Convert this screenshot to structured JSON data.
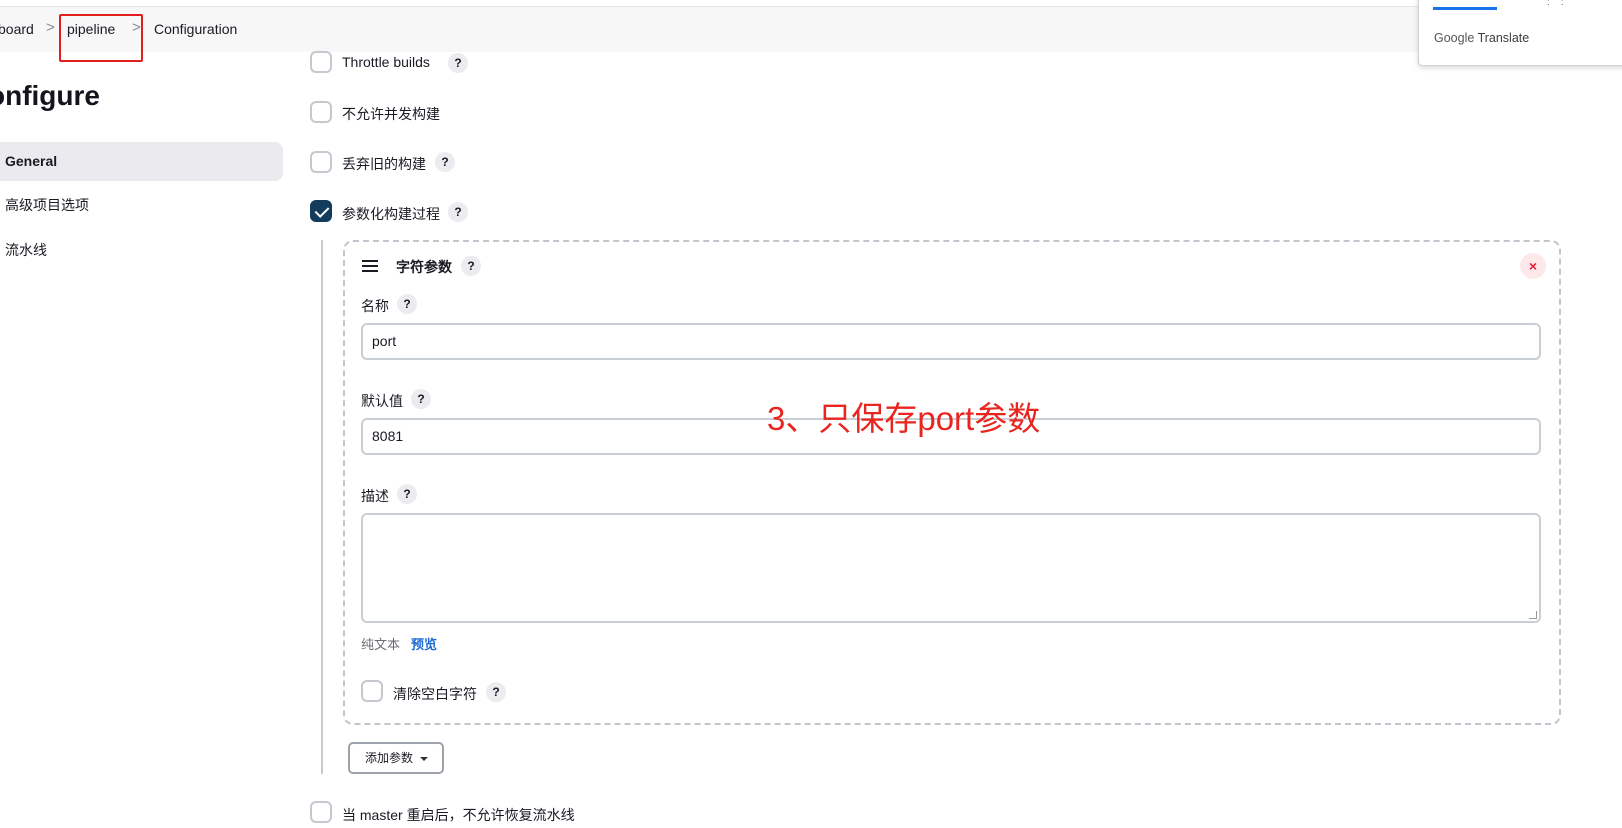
{
  "breadcrumb": {
    "items": [
      "board",
      "pipeline",
      "Configuration"
    ],
    "separator": ">"
  },
  "google_translate": {
    "brand": "Google",
    "product": "Translate"
  },
  "page": {
    "title": "onfigure"
  },
  "sidebar": {
    "items": [
      {
        "label": "General",
        "active": true
      },
      {
        "label": "高级项目选项",
        "active": false
      },
      {
        "label": "流水线",
        "active": false
      }
    ]
  },
  "options": {
    "throttle": {
      "label": "Throttle builds",
      "checked": false
    },
    "no_concurrent": {
      "label": "不允许并发构建",
      "checked": false
    },
    "discard_old": {
      "label": "丢弃旧的构建",
      "checked": false
    },
    "parameterized": {
      "label": "参数化构建过程",
      "checked": true
    },
    "no_resume": {
      "label": "当 master 重启后，不允许恢复流水线",
      "checked": false
    }
  },
  "param": {
    "title": "字符参数",
    "close_glyph": "×",
    "name_label": "名称",
    "name_value": "port",
    "default_label": "默认值",
    "default_value": "8081",
    "desc_label": "描述",
    "desc_value": "",
    "format_text": "纯文本",
    "preview_link": "预览",
    "trim_label": "清除空白字符",
    "trim_checked": false
  },
  "add_param_button": "添加参数",
  "help_glyph": "?",
  "annotation": {
    "text": "3、只保存port参数",
    "color": "#e8251f"
  },
  "colors": {
    "checkbox_checked": "#123b5c",
    "link": "#1c6bd4",
    "highlight_box": "#e11d1d"
  }
}
